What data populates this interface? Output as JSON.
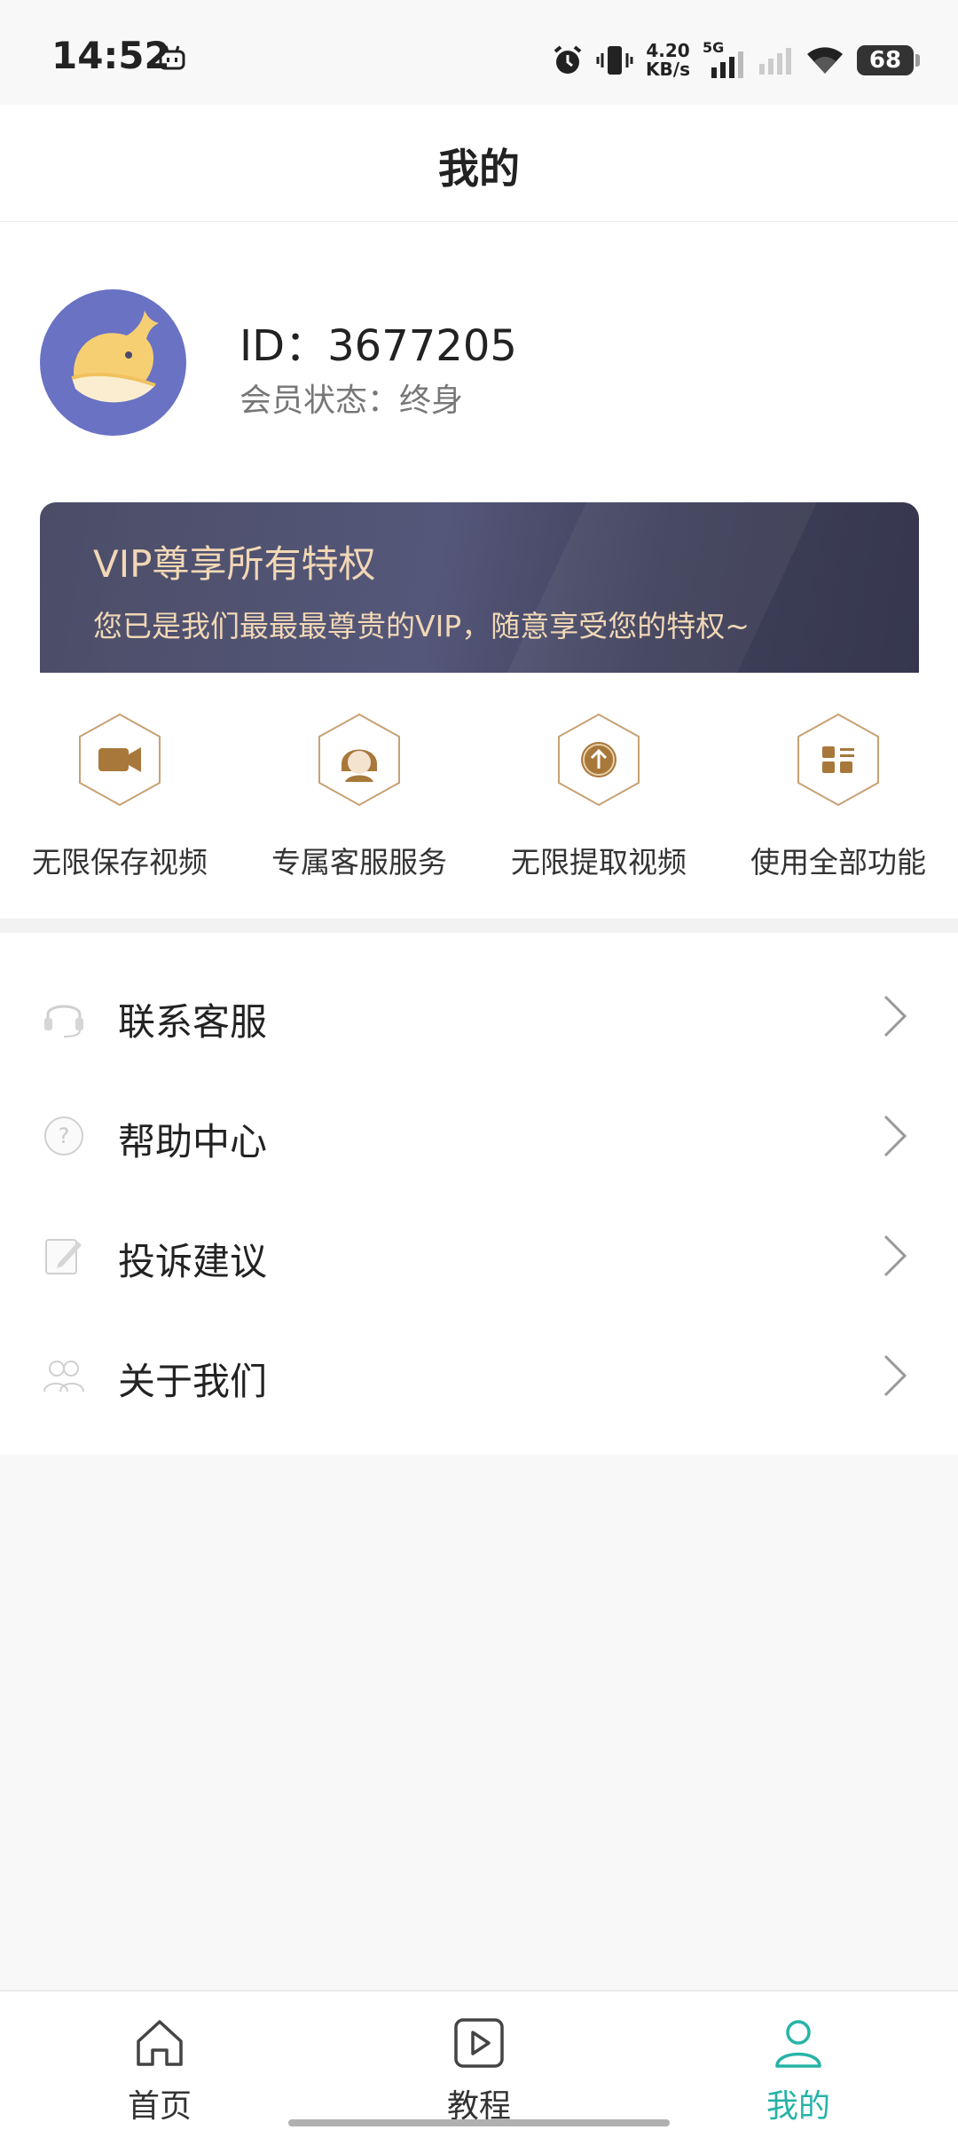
{
  "status_bar": {
    "time": "14:52",
    "speed_value": "4.20",
    "speed_unit": "KB/s",
    "network": "5G",
    "battery": "68"
  },
  "header": {
    "title": "我的"
  },
  "profile": {
    "id_text": "ID：3677205",
    "member_status_label": "会员状态：",
    "member_status_value": "终身"
  },
  "vip": {
    "title": "VIP尊享所有特权",
    "description": "您已是我们最最最尊贵的VIP，随意享受您的特权~"
  },
  "privileges": [
    {
      "label": "无限保存视频",
      "icon": "video-camera-icon"
    },
    {
      "label": "专属客服服务",
      "icon": "customer-service-agent-icon"
    },
    {
      "label": "无限提取视频",
      "icon": "upload-arrow-icon"
    },
    {
      "label": "使用全部功能",
      "icon": "apps-grid-icon"
    }
  ],
  "menu": [
    {
      "label": "联系客服",
      "icon": "headset-icon"
    },
    {
      "label": "帮助中心",
      "icon": "help-question-icon"
    },
    {
      "label": "投诉建议",
      "icon": "edit-feedback-icon"
    },
    {
      "label": "关于我们",
      "icon": "users-group-icon"
    }
  ],
  "bottom_nav": {
    "items": [
      {
        "label": "首页",
        "icon": "home-icon"
      },
      {
        "label": "教程",
        "icon": "play-tutorial-icon"
      },
      {
        "label": "我的",
        "icon": "user-profile-icon",
        "active": true
      }
    ]
  },
  "colors": {
    "accent": "#26b3a7",
    "vip_gold": "#f1d7b5",
    "privilege_brown": "#a8783b",
    "avatar_bg": "#6a72c4"
  }
}
